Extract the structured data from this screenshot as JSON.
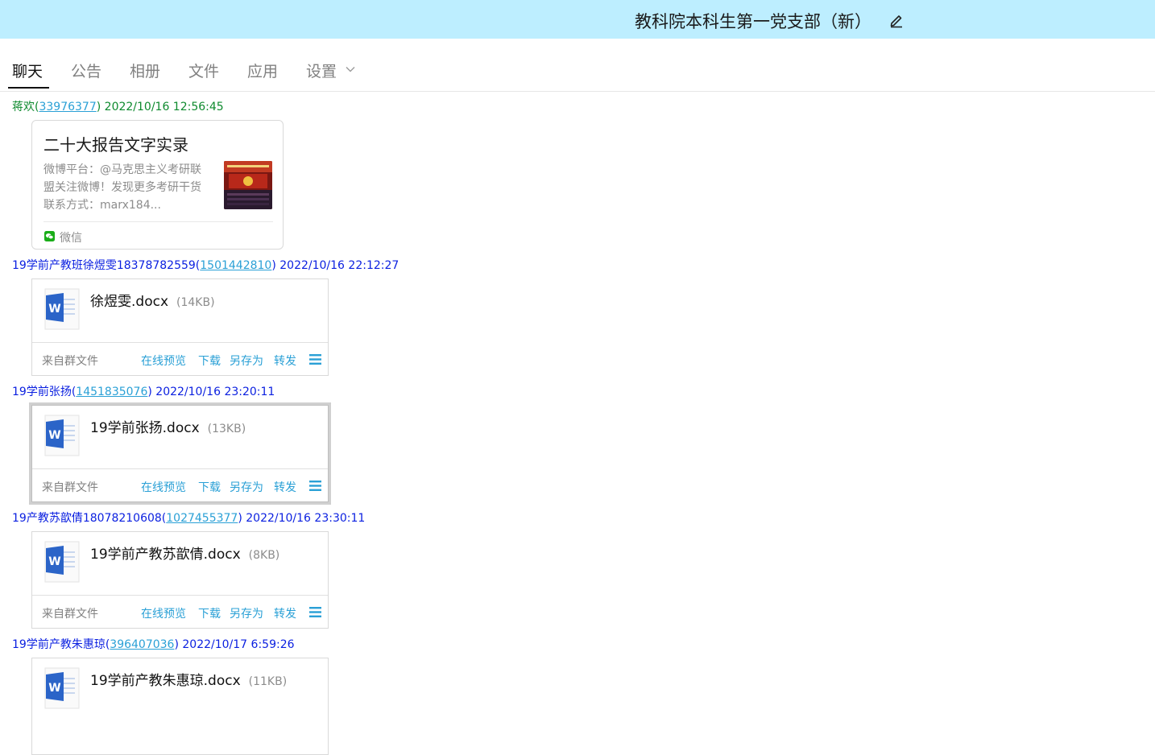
{
  "header": {
    "title": "教科院本科生第一党支部（新）"
  },
  "tabs": [
    {
      "label": "聊天",
      "active": true
    },
    {
      "label": "公告"
    },
    {
      "label": "相册"
    },
    {
      "label": "文件"
    },
    {
      "label": "应用"
    },
    {
      "label": "设置"
    }
  ],
  "colors": {
    "topbar": "#bdeeff",
    "link": "#2aa0d6",
    "sender_green": "#0e8a2e",
    "sender_blue": "#0a1fe0"
  },
  "messages": [
    {
      "sender": "蒋欢",
      "qq": "33976377",
      "time": "2022/10/16 12:56:45",
      "share": {
        "title": "二十大报告文字实录",
        "desc_lines": [
          "微博平台：@马克思主义考研联",
          "盟关注微博！发现更多考研干货",
          "联系方式：marx184..."
        ],
        "source": "微信",
        "source_icon": "wechat-icon"
      }
    },
    {
      "sender": "19学前产教班徐煜雯18378782559",
      "qq": "1501442810",
      "time": "2022/10/16 22:12:27",
      "file": {
        "name": "徐煜雯.docx",
        "size": "(14KB)"
      }
    },
    {
      "sender": "19学前张扬",
      "qq": "1451835076",
      "time": "2022/10/16 23:20:11",
      "file": {
        "name": "19学前张扬.docx",
        "size": "(13KB)"
      }
    },
    {
      "sender": "19产教苏歆倩18078210608",
      "qq": "1027455377",
      "time": "2022/10/16 23:30:11",
      "file": {
        "name": "19学前产教苏歆倩.docx",
        "size": "(8KB)"
      }
    },
    {
      "sender": "19学前产教朱惠琼",
      "qq": "396407036",
      "time": "2022/10/17 6:59:26",
      "file": {
        "name": "19学前产教朱惠琼.docx",
        "size": "(11KB)"
      }
    }
  ],
  "file_card": {
    "origin": "来自群文件",
    "actions": {
      "preview": "在线预览",
      "download": "下载",
      "save_as": "另存为",
      "forward": "转发"
    },
    "file_icon": "word-doc-icon",
    "menu_icon": "hamburger-menu-icon"
  }
}
